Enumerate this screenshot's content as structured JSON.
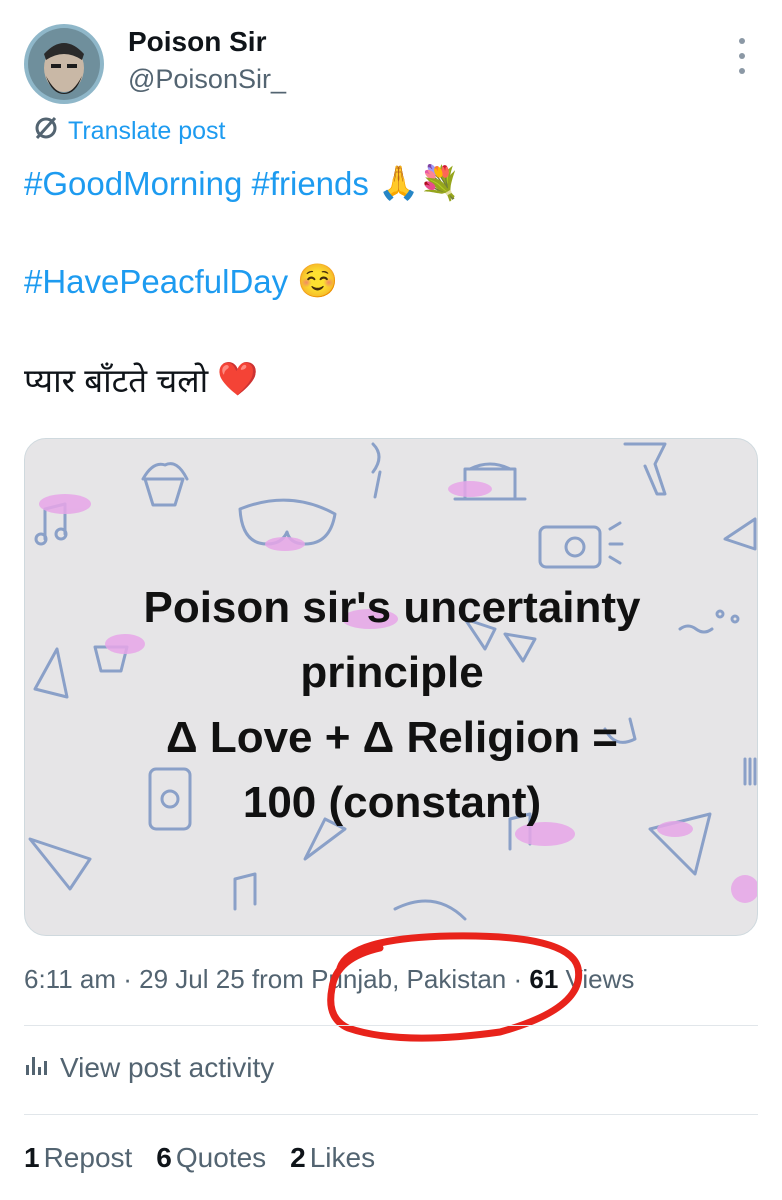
{
  "author": {
    "display_name": "Poison Sir",
    "handle": "@PoisonSir_"
  },
  "translate_label": "Translate post",
  "post": {
    "line1_tags": [
      "#GoodMorning",
      "#friends"
    ],
    "line1_emoji": "🙏💐",
    "line2_tag": "#HavePeacfulDay",
    "line2_emoji": "☺️",
    "line3_text": "प्यार बाँटते चलो",
    "line3_emoji": "❤️"
  },
  "media": {
    "lines": [
      "Poison sir's uncertainty",
      "principle",
      "Δ Love + Δ Religion =",
      "100 (constant)"
    ]
  },
  "meta": {
    "time": "6:11 am",
    "date": "29 Jul 25",
    "from_prefix": "from",
    "location": "Punjab, Pakistan",
    "views_count": "61",
    "views_label": "Views"
  },
  "activity_label": "View post activity",
  "stats": {
    "reposts_count": "1",
    "reposts_label": "Repost",
    "quotes_count": "6",
    "quotes_label": "Quotes",
    "likes_count": "2",
    "likes_label": "Likes"
  },
  "colors": {
    "link": "#1d9bf0",
    "secondary_text": "#536471",
    "annotation": "#e8231b"
  }
}
